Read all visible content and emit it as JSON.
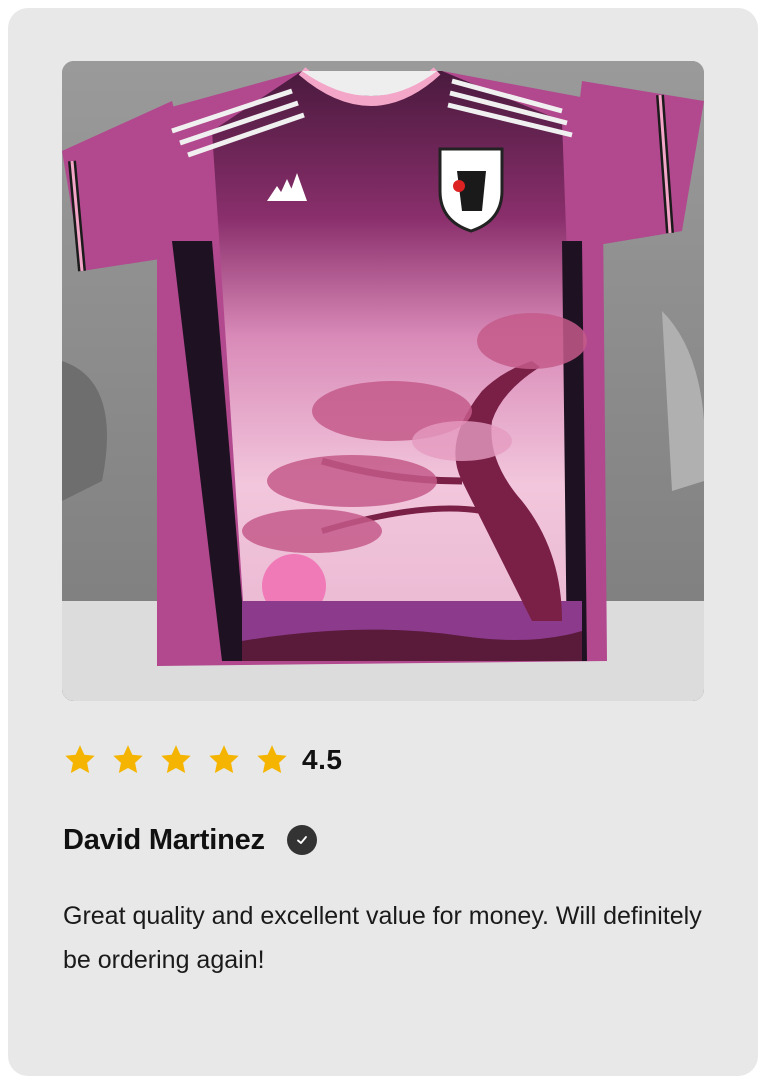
{
  "review": {
    "image_alt": "Pink Japan football jersey with cherry blossom tree design",
    "rating": {
      "stars": 5,
      "value": "4.5"
    },
    "author": {
      "name": "David Martinez",
      "verified_icon": "verified-check-icon"
    },
    "text": "Great quality and excellent value for money. Will definitely be ordering again!"
  },
  "colors": {
    "card_background": "#e8e8e8",
    "star": "#f5b400",
    "text": "#111111",
    "verified_badge": "#333333"
  }
}
